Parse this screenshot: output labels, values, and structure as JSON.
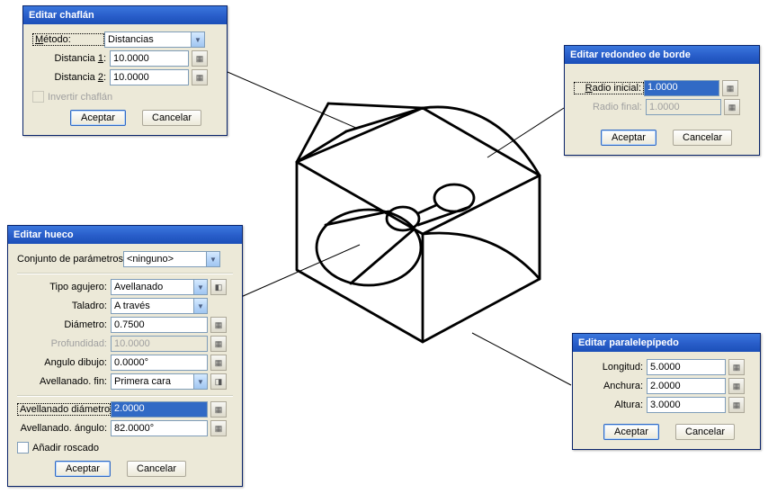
{
  "chaflan": {
    "title": "Editar chaflán",
    "metodo_label": "Método:",
    "metodo_value": "Distancias",
    "d1_label": "Distancia 1:",
    "d1_value": "10.0000",
    "d2_label": "Distancia 2:",
    "d2_value": "10.0000",
    "invertir_label": "Invertir chaflán",
    "accept": "Aceptar",
    "cancel": "Cancelar"
  },
  "redondeo": {
    "title": "Editar redondeo de borde",
    "ri_label": "Radio inicial:",
    "ri_value": "1.0000",
    "rf_label": "Radio final:",
    "rf_value": "1.0000",
    "accept": "Aceptar",
    "cancel": "Cancelar"
  },
  "hueco": {
    "title": "Editar hueco",
    "conjunto_label": "Conjunto de parámetros:",
    "conjunto_value": "<ninguno>",
    "tipo_label": "Tipo agujero:",
    "tipo_value": "Avellanado",
    "taladro_label": "Taladro:",
    "taladro_value": "A través",
    "diam_label": "Diámetro:",
    "diam_value": "0.7500",
    "prof_label": "Profundidad:",
    "prof_value": "10.0000",
    "angulo_label": "Angulo dibujo:",
    "angulo_value": "0.0000°",
    "avfin_label": "Avellanado. fin:",
    "avfin_value": "Primera cara",
    "avdiam_label": "Avellanado diámetro:",
    "avdiam_value": "2.0000",
    "avang_label": "Avellanado. ángulo:",
    "avang_value": "82.0000°",
    "roscado_label": "Añadir roscado",
    "accept": "Aceptar",
    "cancel": "Cancelar"
  },
  "para": {
    "title": "Editar paralelepípedo",
    "long_label": "Longitud:",
    "long_value": "5.0000",
    "anch_label": "Anchura:",
    "anch_value": "2.0000",
    "alt_label": "Altura:",
    "alt_value": "3.0000",
    "accept": "Aceptar",
    "cancel": "Cancelar"
  }
}
